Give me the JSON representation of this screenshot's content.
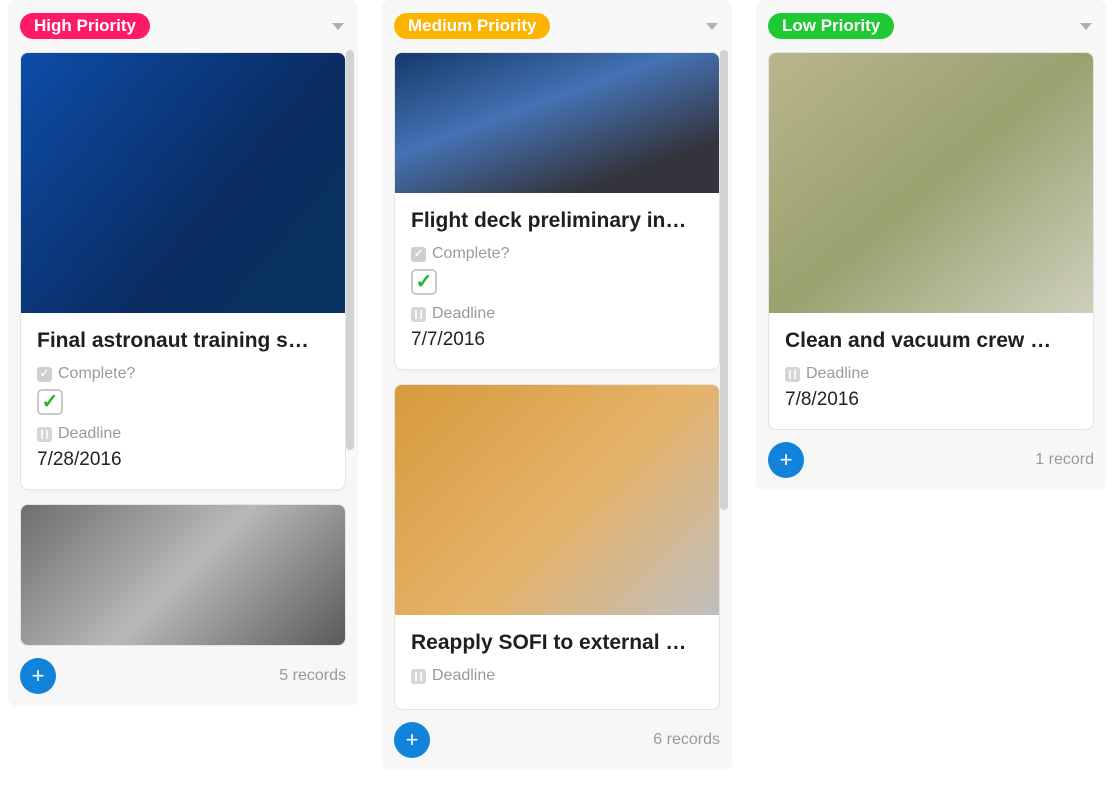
{
  "field_labels": {
    "complete": "Complete?",
    "deadline": "Deadline"
  },
  "columns": [
    {
      "id": "high",
      "badge_label": "High Priority",
      "badge_color": "#ff1a66",
      "record_count_label": "5 records",
      "scroll_height": 400,
      "cards": [
        {
          "title": "Final astronaut training s…",
          "image_class": "ph-astronaut",
          "image_height": "tall",
          "show_complete": true,
          "complete_checked": true,
          "show_deadline": true,
          "deadline": "7/28/2016"
        },
        {
          "title": "",
          "image_class": "ph-station",
          "image_height": "short",
          "show_complete": false,
          "complete_checked": false,
          "show_deadline": false,
          "deadline": "",
          "truncated_body": true
        }
      ]
    },
    {
      "id": "medium",
      "badge_label": "Medium Priority",
      "badge_color": "#fcb400",
      "record_count_label": "6 records",
      "scroll_height": 460,
      "cards": [
        {
          "title": "Flight deck preliminary in…",
          "image_class": "ph-cockpit",
          "image_height": "short",
          "show_complete": true,
          "complete_checked": true,
          "show_deadline": true,
          "deadline": "7/7/2016"
        },
        {
          "title": "Reapply SOFI to external …",
          "image_class": "ph-tank",
          "image_height": "mid",
          "show_complete": false,
          "complete_checked": false,
          "show_deadline": true,
          "deadline": "",
          "deadline_label_only": true
        }
      ]
    },
    {
      "id": "low",
      "badge_label": "Low Priority",
      "badge_color": "#20c933",
      "record_count_label": "1 record",
      "scroll_height": 0,
      "cards": [
        {
          "title": "Clean and vacuum crew …",
          "image_class": "ph-crewmod",
          "image_height": "mid2",
          "show_complete": false,
          "complete_checked": false,
          "show_deadline": true,
          "deadline": "7/8/2016"
        }
      ]
    }
  ]
}
